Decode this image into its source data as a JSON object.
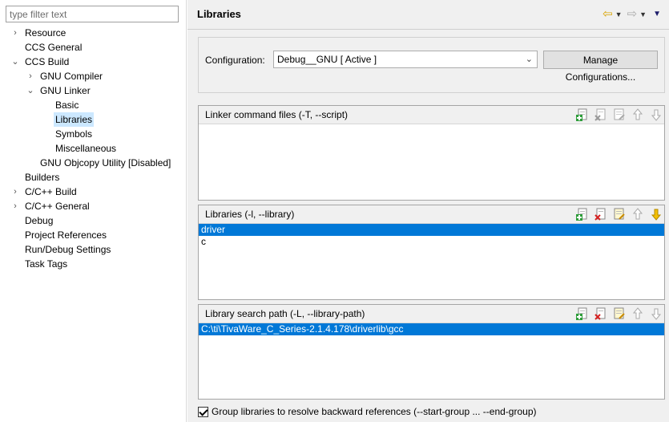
{
  "filter": {
    "placeholder": "type filter text"
  },
  "tree": [
    {
      "label": "Resource",
      "twisty": "›",
      "indent": 0,
      "selected": false
    },
    {
      "label": "CCS General",
      "twisty": "",
      "indent": 0,
      "selected": false
    },
    {
      "label": "CCS Build",
      "twisty": "⌄",
      "indent": 0,
      "selected": false
    },
    {
      "label": "GNU Compiler",
      "twisty": "›",
      "indent": 1,
      "selected": false
    },
    {
      "label": "GNU Linker",
      "twisty": "⌄",
      "indent": 1,
      "selected": false
    },
    {
      "label": "Basic",
      "twisty": "",
      "indent": 2,
      "selected": false
    },
    {
      "label": "Libraries",
      "twisty": "",
      "indent": 2,
      "selected": true
    },
    {
      "label": "Symbols",
      "twisty": "",
      "indent": 2,
      "selected": false
    },
    {
      "label": "Miscellaneous",
      "twisty": "",
      "indent": 2,
      "selected": false
    },
    {
      "label": "GNU Objcopy Utility  [Disabled]",
      "twisty": "",
      "indent": 1,
      "selected": false
    },
    {
      "label": "Builders",
      "twisty": "",
      "indent": 0,
      "selected": false
    },
    {
      "label": "C/C++ Build",
      "twisty": "›",
      "indent": 0,
      "selected": false
    },
    {
      "label": "C/C++ General",
      "twisty": "›",
      "indent": 0,
      "selected": false
    },
    {
      "label": "Debug",
      "twisty": "",
      "indent": 0,
      "selected": false
    },
    {
      "label": "Project References",
      "twisty": "",
      "indent": 0,
      "selected": false
    },
    {
      "label": "Run/Debug Settings",
      "twisty": "",
      "indent": 0,
      "selected": false
    },
    {
      "label": "Task Tags",
      "twisty": "",
      "indent": 0,
      "selected": false
    }
  ],
  "page": {
    "title": "Libraries"
  },
  "nav": {
    "back_icon": "back-arrow-icon",
    "forward_icon": "forward-arrow-icon",
    "menu_icon": "view-menu-icon"
  },
  "configuration": {
    "label": "Configuration:",
    "value": "Debug__GNU  [ Active ]",
    "manage_label": "Manage Configurations..."
  },
  "panels": {
    "linker": {
      "title": "Linker command files (-T, --script)",
      "items": []
    },
    "libraries": {
      "title": "Libraries (-l, --library)",
      "items": [
        {
          "text": "driver",
          "selected": true
        },
        {
          "text": "c",
          "selected": false
        }
      ]
    },
    "search_path": {
      "title": "Library search path (-L, --library-path)",
      "items": [
        {
          "text": "C:\\ti\\TivaWare_C_Series-2.1.4.178\\driverlib\\gcc",
          "selected": true
        }
      ]
    }
  },
  "group_libraries": {
    "label": "Group libraries to resolve backward references (--start-group ... --end-group)",
    "checked": true
  },
  "colors": {
    "selection": "#0078d7",
    "tree_selection": "#cce8ff",
    "panel_bg": "#f0f0f0"
  }
}
